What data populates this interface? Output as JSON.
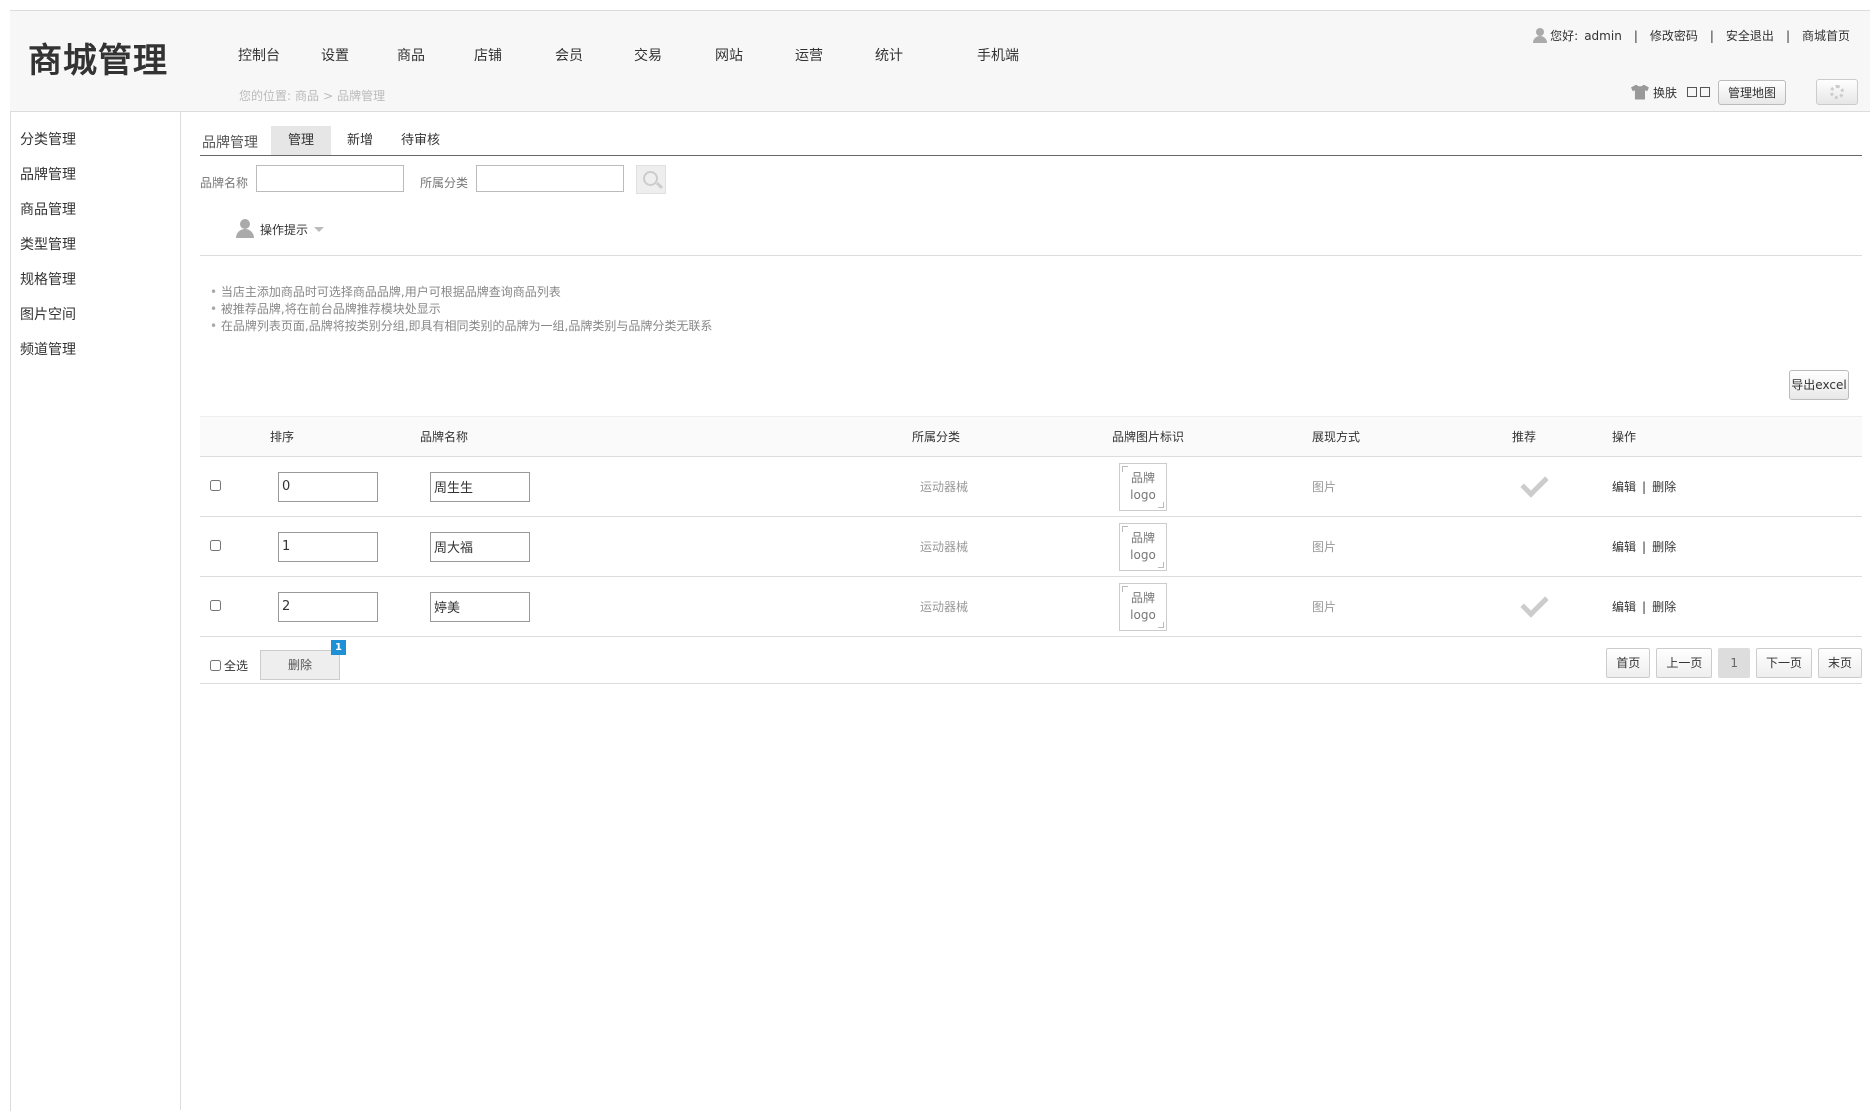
{
  "header": {
    "title": "商城管理",
    "nav": [
      "控制台",
      "设置",
      "商品",
      "店铺",
      "会员",
      "交易",
      "网站",
      "运营",
      "统计",
      "手机端"
    ],
    "breadcrumb": {
      "prefix": "您的位置:",
      "level1": "商品",
      "arrow": ">",
      "level2": "品牌管理"
    },
    "user": {
      "greeting": "您好:",
      "name": "admin",
      "change_password": "修改密码",
      "logout": "安全退出",
      "shop_home": "商城首页",
      "sep": "|"
    },
    "skin_label": "换肤",
    "admin_map_label": "管理地图"
  },
  "sidebar": {
    "items": [
      "分类管理",
      "品牌管理",
      "商品管理",
      "类型管理",
      "规格管理",
      "图片空间",
      "频道管理"
    ]
  },
  "main": {
    "section_title": "品牌管理",
    "tabs": [
      "管理",
      "新增",
      "待审核"
    ],
    "search": {
      "brand_name_label": "品牌名称",
      "category_label": "所属分类",
      "brand_name_value": "",
      "category_value": ""
    },
    "tips_title": "操作提示",
    "tips": [
      "当店主添加商品时可选择商品品牌,用户可根据品牌查询商品列表",
      "被推荐品牌,将在前台品牌推荐模块处显示",
      "在品牌列表页面,品牌将按类别分组,即具有相同类别的品牌为一组,品牌类别与品牌分类无联系"
    ],
    "export_label": "导出excel",
    "columns": [
      "排序",
      "品牌名称",
      "所属分类",
      "品牌图片标识",
      "展现方式",
      "推荐",
      "操作"
    ],
    "rows": [
      {
        "sort": "0",
        "name": "周生生",
        "category": "运动器械",
        "logo_line1": "品牌",
        "logo_line2": "logo",
        "display": "图片",
        "recommended": true,
        "edit": "编辑",
        "delete": "删除"
      },
      {
        "sort": "1",
        "name": "周大福",
        "category": "运动器械",
        "logo_line1": "品牌",
        "logo_line2": "logo",
        "display": "图片",
        "recommended": false,
        "edit": "编辑",
        "delete": "删除"
      },
      {
        "sort": "2",
        "name": "婷美",
        "category": "运动器械",
        "logo_line1": "品牌",
        "logo_line2": "logo",
        "display": "图片",
        "recommended": true,
        "edit": "编辑",
        "delete": "删除"
      }
    ],
    "footer": {
      "select_all": "全选",
      "delete": "删除",
      "badge": "1"
    },
    "pager": {
      "first": "首页",
      "prev": "上一页",
      "current": "1",
      "next": "下一页",
      "last": "末页"
    }
  }
}
